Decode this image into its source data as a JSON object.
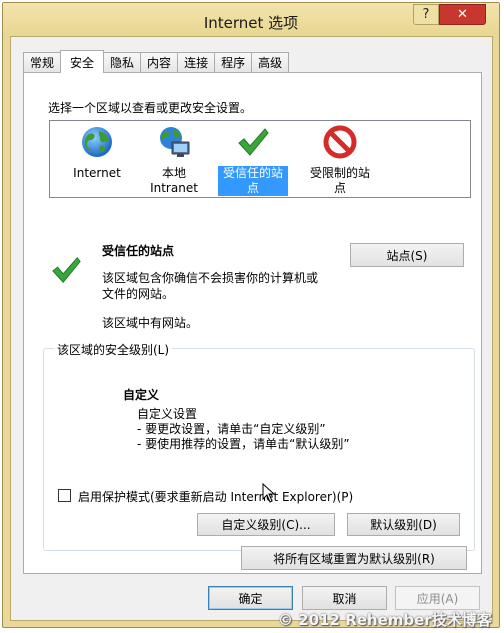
{
  "window": {
    "title": "Internet 选项",
    "help_button": "?",
    "close_button": "✕"
  },
  "tabs": [
    {
      "label": "常规",
      "active": false
    },
    {
      "label": "安全",
      "active": true
    },
    {
      "label": "隐私",
      "active": false
    },
    {
      "label": "内容",
      "active": false
    },
    {
      "label": "连接",
      "active": false
    },
    {
      "label": "程序",
      "active": false
    },
    {
      "label": "高级",
      "active": false
    }
  ],
  "security": {
    "zone_prompt": "选择一个区域以查看或更改安全设置。",
    "zones": [
      {
        "line1": "Internet",
        "line2": "",
        "icon": "globe-icon",
        "selected": false
      },
      {
        "line1": "本地",
        "line2": "Intranet",
        "icon": "local-intranet-icon",
        "selected": false
      },
      {
        "line1": "受信任的站",
        "line2": "点",
        "icon": "checkmark-icon",
        "selected": true
      },
      {
        "line1": "受限制的站",
        "line2": "点",
        "icon": "restricted-icon",
        "selected": false
      }
    ],
    "selected_zone": {
      "title": "受信任的站点",
      "desc_line1": "该区域包含你确信不会损害你的计算机或",
      "desc_line2": "文件的网站。",
      "status": "该区域中有网站。",
      "sites_button": "站点(S)"
    },
    "level_group": {
      "title": "该区域的安全级别(L)",
      "level_name": "自定义",
      "line1": "自定义设置",
      "line2": "- 要更改设置，请单击“自定义级别”",
      "line3": "- 要使用推荐的设置，请单击“默认级别”"
    },
    "protected_mode": {
      "label": "启用保护模式(要求重新启动 Internet Explorer)(P)",
      "checked": false
    },
    "custom_level_button": "自定义级别(C)...",
    "default_level_button": "默认级别(D)",
    "reset_all_button": "将所有区域重置为默认级别(R)"
  },
  "footer": {
    "ok": "确定",
    "cancel": "取消",
    "apply": "应用(A)"
  },
  "watermark": "© 2012 Rehember技术博客",
  "colors": {
    "frame": "#e9d89a",
    "close": "#c7372f",
    "selection": "#3399ff",
    "check_green": "#3aa63a",
    "restricted_red": "#d42b2b"
  }
}
